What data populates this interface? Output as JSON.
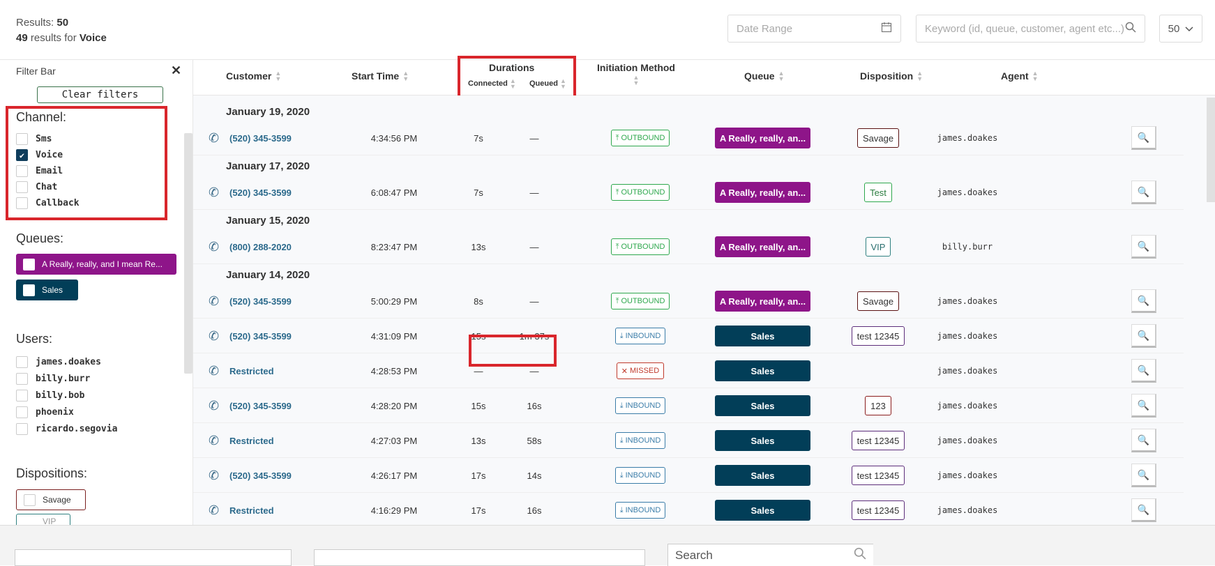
{
  "header": {
    "results_label": "Results:",
    "results_count": "50",
    "results_for_count": "49",
    "results_for_text": "results for",
    "results_for_channel": "Voice",
    "date_range_placeholder": "Date Range",
    "keyword_placeholder": "Keyword (id, queue, customer, agent etc...)",
    "page_size": "50"
  },
  "sidebar": {
    "title": "Filter Bar",
    "close": "✕",
    "clear_filters": "Clear filters",
    "channel_title": "Channel:",
    "channels": [
      {
        "label": "Sms",
        "checked": false
      },
      {
        "label": "Voice",
        "checked": true
      },
      {
        "label": "Email",
        "checked": false
      },
      {
        "label": "Chat",
        "checked": false
      },
      {
        "label": "Callback",
        "checked": false
      }
    ],
    "queues_title": "Queues:",
    "queues": [
      "A Really, really, and I mean Re...",
      "Sales"
    ],
    "users_title": "Users:",
    "users": [
      "james.doakes",
      "billy.burr",
      "billy.bob",
      "phoenix",
      "ricardo.segovia"
    ],
    "dispositions_title": "Dispositions:",
    "dispositions": [
      "Savage",
      "VIP"
    ]
  },
  "table": {
    "columns": {
      "customer": "Customer",
      "start_time": "Start Time",
      "durations": "Durations",
      "connected": "Connected",
      "queued": "Queued",
      "initiation": "Initiation Method",
      "queue": "Queue",
      "disposition": "Disposition",
      "agent": "Agent"
    },
    "dates": [
      "January 19, 2020",
      "January 17, 2020",
      "January 15, 2020",
      "January 14, 2020"
    ],
    "rows": [
      {
        "customer": "(520) 345-3599",
        "start": "4:34:56 PM",
        "connected": "7s",
        "queued": "—",
        "init": "OUTBOUND",
        "queue": "A Really, really, an...",
        "disposition": "Savage",
        "agent": "james.doakes"
      },
      {
        "customer": "(520) 345-3599",
        "start": "6:08:47 PM",
        "connected": "7s",
        "queued": "—",
        "init": "OUTBOUND",
        "queue": "A Really, really, an...",
        "disposition": "Test",
        "agent": "james.doakes"
      },
      {
        "customer": "(800) 288-2020",
        "start": "8:23:47 PM",
        "connected": "13s",
        "queued": "—",
        "init": "OUTBOUND",
        "queue": "A Really, really, an...",
        "disposition": "VIP",
        "agent": "billy.burr"
      },
      {
        "customer": "(520) 345-3599",
        "start": "5:00:29 PM",
        "connected": "8s",
        "queued": "—",
        "init": "OUTBOUND",
        "queue": "A Really, really, an...",
        "disposition": "Savage",
        "agent": "james.doakes"
      },
      {
        "customer": "(520) 345-3599",
        "start": "4:31:09 PM",
        "connected": "15s",
        "queued": "1m 37s",
        "init": "INBOUND",
        "queue": "Sales",
        "disposition": "test 12345",
        "agent": "james.doakes"
      },
      {
        "customer": "Restricted",
        "start": "4:28:53 PM",
        "connected": "—",
        "queued": "—",
        "init": "MISSED",
        "queue": "Sales",
        "disposition": "",
        "agent": "james.doakes"
      },
      {
        "customer": "(520) 345-3599",
        "start": "4:28:20 PM",
        "connected": "15s",
        "queued": "16s",
        "init": "INBOUND",
        "queue": "Sales",
        "disposition": "123",
        "agent": "james.doakes"
      },
      {
        "customer": "Restricted",
        "start": "4:27:03 PM",
        "connected": "13s",
        "queued": "58s",
        "init": "INBOUND",
        "queue": "Sales",
        "disposition": "test 12345",
        "agent": "james.doakes"
      },
      {
        "customer": "(520) 345-3599",
        "start": "4:26:17 PM",
        "connected": "17s",
        "queued": "14s",
        "init": "INBOUND",
        "queue": "Sales",
        "disposition": "test 12345",
        "agent": "james.doakes"
      },
      {
        "customer": "Restricted",
        "start": "4:16:29 PM",
        "connected": "17s",
        "queued": "16s",
        "init": "INBOUND",
        "queue": "Sales",
        "disposition": "test 12345",
        "agent": "james.doakes"
      }
    ]
  },
  "bottom": {
    "search_label": "Search"
  },
  "colors": {
    "purple": "#8e1589",
    "navy": "#023e58",
    "highlight": "#d9262c",
    "outbound": "#2ea84d",
    "inbound": "#3a7ca8",
    "missed": "#c0392b"
  }
}
